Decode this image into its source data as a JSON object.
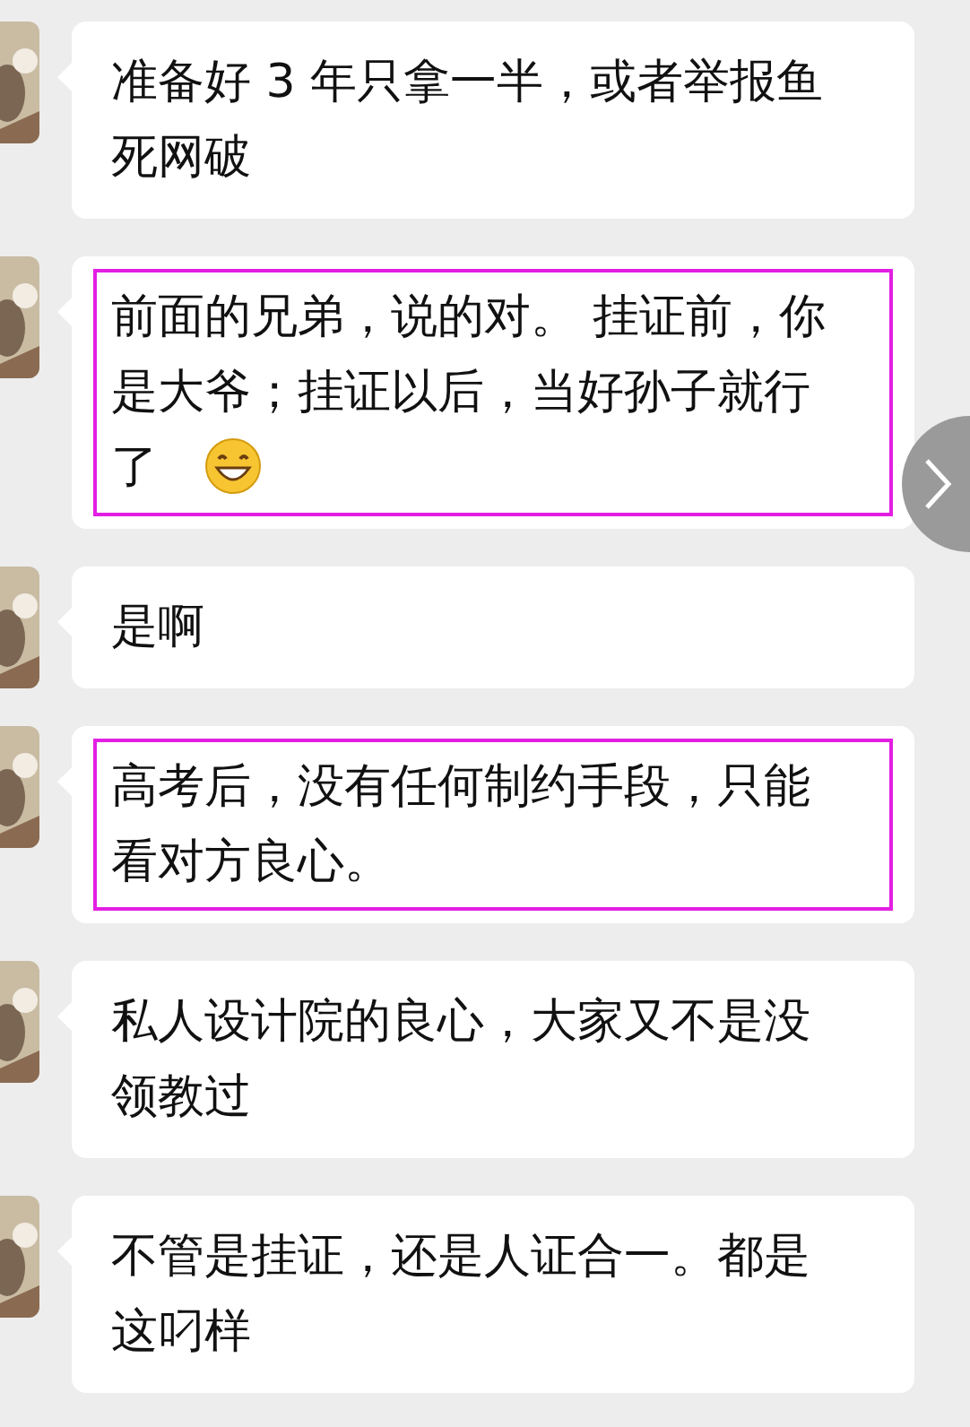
{
  "messages": [
    {
      "avatar": {
        "kind": "picture"
      },
      "lines": [
        "准备好 3 年只拿一半，或者举报鱼",
        "死网破"
      ],
      "highlighted": false,
      "emoji": false
    },
    {
      "avatar": {
        "kind": "picture"
      },
      "lines": [
        "前面的兄弟，说的对。 挂证前，你",
        "是大爷；挂证以后，当好孙子就行",
        "了"
      ],
      "highlighted": true,
      "emoji": true
    },
    {
      "avatar": {
        "kind": "picture"
      },
      "lines": [
        "是啊"
      ],
      "highlighted": false,
      "emoji": false
    },
    {
      "avatar": {
        "kind": "picture"
      },
      "lines": [
        "高考后，没有任何制约手段，只能",
        "看对方良心。"
      ],
      "highlighted": true,
      "emoji": false
    },
    {
      "avatar": {
        "kind": "picture"
      },
      "lines": [
        "私人设计院的良心，大家又不是没",
        "领教过"
      ],
      "highlighted": false,
      "emoji": false
    },
    {
      "avatar": {
        "kind": "picture"
      },
      "lines": [
        "不管是挂证，还是人证合一。都是",
        "这叼样"
      ],
      "highlighted": false,
      "emoji": false
    }
  ]
}
